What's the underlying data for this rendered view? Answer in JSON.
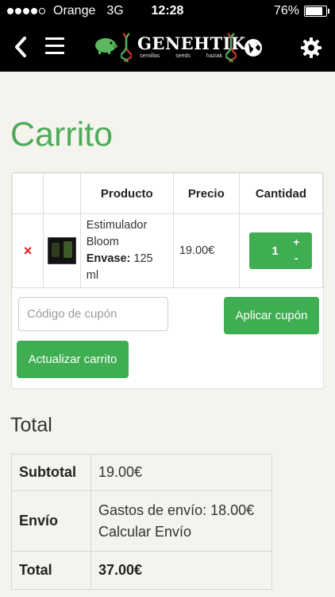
{
  "status": {
    "carrier": "Orange",
    "network": "3G",
    "time": "12:28",
    "battery": "76%",
    "battery_level": 0.76
  },
  "nav": {
    "logo_text": "GENEHTIK",
    "logo_sub": "semillas seeds haziak",
    "icons": {
      "back": "chevron-left-icon",
      "menu": "hamburger-icon",
      "settings": "gear-icon",
      "globe": "globe-icon"
    }
  },
  "page_title": "Carrito",
  "cart": {
    "headers": {
      "product": "Producto",
      "price": "Precio",
      "quantity": "Cantidad"
    },
    "item": {
      "remove": "×",
      "name_line1": "Estimulador",
      "name_line2": "Bloom",
      "variant_label": "Envase:",
      "variant_value": "125 ml",
      "price": "19.00€",
      "quantity": "1",
      "plus": "+",
      "minus": "-"
    },
    "coupon_placeholder": "Código de cupón",
    "apply_coupon": "Aplicar cupón",
    "update_cart": "Actualizar carrito"
  },
  "totals": {
    "title": "Total",
    "subtotal_label": "Subtotal",
    "subtotal_value": "19.00€",
    "shipping_label": "Envío",
    "shipping_line1": "Gastos de envío: 18.00€",
    "shipping_line2": "Calcular Envío",
    "total_label": "Total",
    "total_value": "37.00€"
  },
  "colors": {
    "accent": "#4eab5a",
    "button": "#3fae52",
    "remove": "#e02020",
    "bar": "#000000"
  }
}
